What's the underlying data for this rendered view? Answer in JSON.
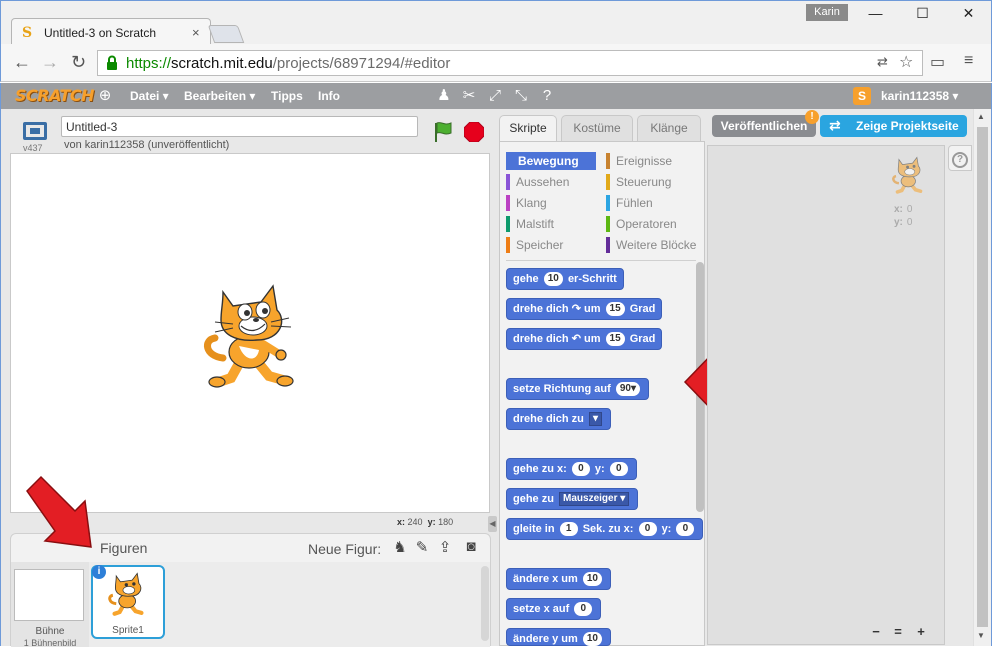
{
  "browser": {
    "tab_title": "Untitled-3 on Scratch",
    "tab_close": "×",
    "user_chip": "Karin",
    "win_min": "—",
    "win_max": "☐",
    "win_close": "✕",
    "url_scheme": "https://",
    "url_host": "scratch.mit.edu",
    "url_path": "/projects/68971294/#editor"
  },
  "menubar": {
    "logo": "SCRATCH",
    "menus": [
      "Datei ▾",
      "Bearbeiten ▾",
      "Tipps",
      "Info"
    ],
    "username": "karin112358 ▾"
  },
  "stage_header": {
    "version": "v437",
    "project_title": "Untitled-3",
    "byline": "von karin112358 (unveröffentlicht)"
  },
  "stage": {
    "coords_x_label": "x:",
    "coords_x": "240",
    "coords_y_label": "y:",
    "coords_y": "180"
  },
  "sprite_pane": {
    "title": "Figuren",
    "new_sprite_label": "Neue Figur:",
    "stage_name": "Bühne",
    "stage_sub": "1 Bühnenbild",
    "sprite_name": "Sprite1",
    "info": "i"
  },
  "palette": {
    "tabs": [
      "Skripte",
      "Kostüme",
      "Klänge"
    ],
    "categories": [
      {
        "label": "Bewegung",
        "color": "#4c73d7"
      },
      {
        "label": "Ereignisse",
        "color": "#c88330"
      },
      {
        "label": "Aussehen",
        "color": "#8a55d7"
      },
      {
        "label": "Steuerung",
        "color": "#e1a91a"
      },
      {
        "label": "Klang",
        "color": "#bb42c3"
      },
      {
        "label": "Fühlen",
        "color": "#2ca5e2"
      },
      {
        "label": "Malstift",
        "color": "#0e9a6c"
      },
      {
        "label": "Operatoren",
        "color": "#5cb712"
      },
      {
        "label": "Speicher",
        "color": "#ee7d16"
      },
      {
        "label": "Weitere Blöcke",
        "color": "#632d99"
      }
    ],
    "blocks": {
      "b1_a": "gehe",
      "b1_n": "10",
      "b1_b": "er-Schritt",
      "b2_a": "drehe dich",
      "b2_icon": "↷",
      "b2_b": "um",
      "b2_n": "15",
      "b2_c": "Grad",
      "b3_a": "drehe dich",
      "b3_icon": "↶",
      "b3_b": "um",
      "b3_n": "15",
      "b3_c": "Grad",
      "b4_a": "setze Richtung auf",
      "b4_n": "90▾",
      "b5_a": "drehe dich zu",
      "b5_dd": "▾",
      "b6_a": "gehe zu x:",
      "b6_n1": "0",
      "b6_b": "y:",
      "b6_n2": "0",
      "b7_a": "gehe zu",
      "b7_dd": "Mauszeiger ▾",
      "b8_a": "gleite in",
      "b8_n1": "1",
      "b8_b": "Sek. zu x:",
      "b8_n2": "0",
      "b8_c": "y:",
      "b8_n3": "0",
      "b9_a": "ändere x um",
      "b9_n": "10",
      "b10_a": "setze x auf",
      "b10_n": "0",
      "b11_a": "ändere y um",
      "b11_n": "10"
    }
  },
  "right": {
    "publish": "Veröffentlichen",
    "publish_badge": "!",
    "project_page": "Zeige Projektseite",
    "sprite_x_label": "x:",
    "sprite_x": "0",
    "sprite_y_label": "y:",
    "sprite_y": "0",
    "zoom_out": "−",
    "zoom_reset": "=",
    "zoom_in": "+",
    "help": "?"
  }
}
